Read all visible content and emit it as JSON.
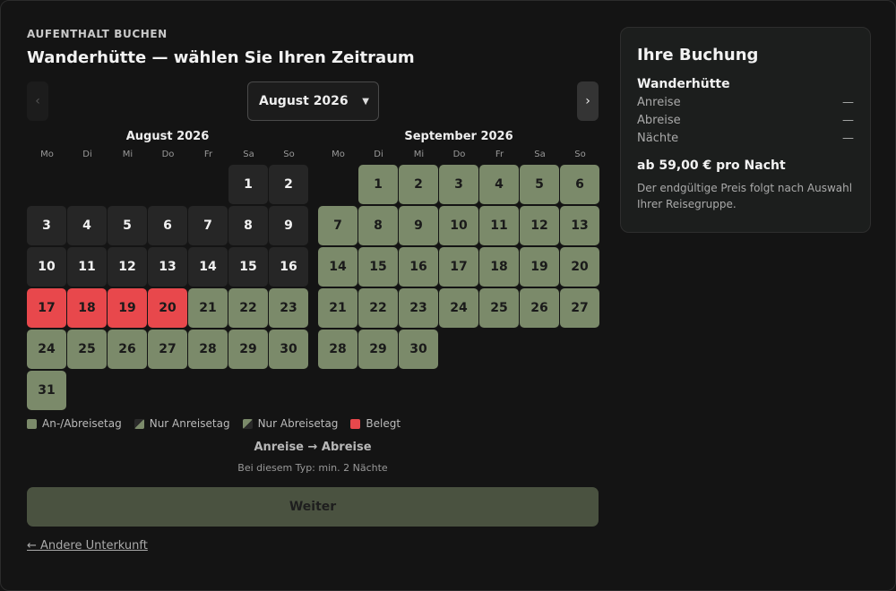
{
  "header": {
    "kicker": "AUFENTHALT BUCHEN",
    "title": "Wanderhütte — wählen Sie Ihren Zeitraum"
  },
  "nav": {
    "prev": "‹",
    "next": "›",
    "month_select": "August 2026"
  },
  "weekdays": [
    "Mo",
    "Di",
    "Mi",
    "Do",
    "Fr",
    "Sa",
    "So"
  ],
  "calendars": [
    {
      "title": "August 2026",
      "offset": 5,
      "days": [
        {
          "d": "1",
          "s": "past"
        },
        {
          "d": "2",
          "s": "past"
        },
        {
          "d": "3",
          "s": "past"
        },
        {
          "d": "4",
          "s": "past"
        },
        {
          "d": "5",
          "s": "past"
        },
        {
          "d": "6",
          "s": "past"
        },
        {
          "d": "7",
          "s": "past"
        },
        {
          "d": "8",
          "s": "past"
        },
        {
          "d": "9",
          "s": "past"
        },
        {
          "d": "10",
          "s": "past"
        },
        {
          "d": "11",
          "s": "past"
        },
        {
          "d": "12",
          "s": "past"
        },
        {
          "d": "13",
          "s": "past"
        },
        {
          "d": "14",
          "s": "past"
        },
        {
          "d": "15",
          "s": "past"
        },
        {
          "d": "16",
          "s": "past"
        },
        {
          "d": "17",
          "s": "booked"
        },
        {
          "d": "18",
          "s": "booked"
        },
        {
          "d": "19",
          "s": "booked"
        },
        {
          "d": "20",
          "s": "booked"
        },
        {
          "d": "21",
          "s": "avail"
        },
        {
          "d": "22",
          "s": "avail"
        },
        {
          "d": "23",
          "s": "avail"
        },
        {
          "d": "24",
          "s": "avail"
        },
        {
          "d": "25",
          "s": "avail"
        },
        {
          "d": "26",
          "s": "avail"
        },
        {
          "d": "27",
          "s": "avail"
        },
        {
          "d": "28",
          "s": "avail"
        },
        {
          "d": "29",
          "s": "avail"
        },
        {
          "d": "30",
          "s": "avail"
        },
        {
          "d": "31",
          "s": "avail"
        }
      ]
    },
    {
      "title": "September 2026",
      "offset": 1,
      "days": [
        {
          "d": "1",
          "s": "avail"
        },
        {
          "d": "2",
          "s": "avail"
        },
        {
          "d": "3",
          "s": "avail"
        },
        {
          "d": "4",
          "s": "avail"
        },
        {
          "d": "5",
          "s": "avail"
        },
        {
          "d": "6",
          "s": "avail"
        },
        {
          "d": "7",
          "s": "avail"
        },
        {
          "d": "8",
          "s": "avail"
        },
        {
          "d": "9",
          "s": "avail"
        },
        {
          "d": "10",
          "s": "avail"
        },
        {
          "d": "11",
          "s": "avail"
        },
        {
          "d": "12",
          "s": "avail"
        },
        {
          "d": "13",
          "s": "avail"
        },
        {
          "d": "14",
          "s": "avail"
        },
        {
          "d": "15",
          "s": "avail"
        },
        {
          "d": "16",
          "s": "avail"
        },
        {
          "d": "17",
          "s": "avail"
        },
        {
          "d": "18",
          "s": "avail"
        },
        {
          "d": "19",
          "s": "avail"
        },
        {
          "d": "20",
          "s": "avail"
        },
        {
          "d": "21",
          "s": "avail"
        },
        {
          "d": "22",
          "s": "avail"
        },
        {
          "d": "23",
          "s": "avail"
        },
        {
          "d": "24",
          "s": "avail"
        },
        {
          "d": "25",
          "s": "avail"
        },
        {
          "d": "26",
          "s": "avail"
        },
        {
          "d": "27",
          "s": "avail"
        },
        {
          "d": "28",
          "s": "avail"
        },
        {
          "d": "29",
          "s": "avail"
        },
        {
          "d": "30",
          "s": "avail"
        }
      ]
    }
  ],
  "legend": {
    "both": "An-/Abreisetag",
    "arrival": "Nur Anreisetag",
    "departure": "Nur Abreisetag",
    "occupied": "Belegt"
  },
  "range_text": "Anreise → Abreise",
  "hint": "Bei diesem Typ: min. 2 Nächte",
  "next_button": "Weiter",
  "back_link": "← Andere Unterkunft",
  "summary": {
    "title": "Ihre Buchung",
    "property": "Wanderhütte",
    "rows": [
      {
        "label": "Anreise",
        "value": "—"
      },
      {
        "label": "Abreise",
        "value": "—"
      },
      {
        "label": "Nächte",
        "value": "—"
      }
    ],
    "price": "ab 59,00 € pro Nacht",
    "note": "Der endgültige Preis folgt nach Auswahl Ihrer Reisegruppe."
  },
  "colors": {
    "available": "#7b8a6a",
    "booked": "#e8484c",
    "past": "#262626",
    "button": "#4a5240"
  }
}
